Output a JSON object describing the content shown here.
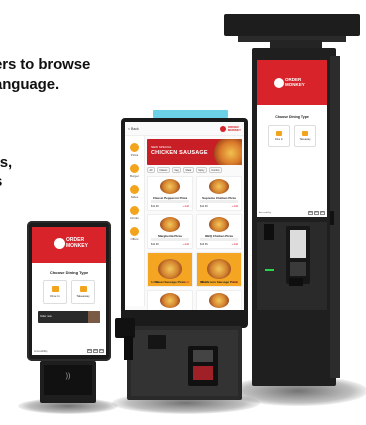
{
  "headline": {
    "line1": "ers to browse",
    "line2": "anguage.",
    "line3": "rs,",
    "line4": "s"
  },
  "brand": {
    "logo_line1": "ORDER",
    "logo_line2": "MONKEY",
    "color": "#d8232a",
    "accent": "#f2a41c"
  },
  "kiosk_left": {
    "title": "Choose Dining Type",
    "option1": "Dine In",
    "option2": "Takeaway",
    "promo": "Order now",
    "footer": "Accessibility",
    "langs": [
      "EN",
      "FR",
      "ES"
    ],
    "contactless_icon": "contactless-icon"
  },
  "kiosk_center": {
    "back": "< Back",
    "hero_sub": "NEW SPECIAL",
    "hero_title": "CHICKEN SAUSAGE",
    "categories": [
      "Pizza",
      "Burger",
      "Sides",
      "Drinks",
      "Offers"
    ],
    "tabs": [
      "All",
      "Classic",
      "Veg",
      "Meat",
      "Spicy",
      "Combo"
    ],
    "items": [
      {
        "name": "Classic Pepperoni Pizza",
        "price": "$12.99",
        "add": "+ Add"
      },
      {
        "name": "Supreme Chicken Pizza",
        "price": "$14.99",
        "add": "+ Add"
      },
      {
        "name": "Margherita Pizza",
        "price": "$10.99",
        "add": "+ Add"
      },
      {
        "name": "BBQ Chicken Pizza",
        "price": "$13.99",
        "add": "+ Add"
      },
      {
        "name": "Sweet Sausage Pizza",
        "price": "$12.49",
        "add": "+ Add"
      },
      {
        "name": "Mushroom Sausage Pizza",
        "price": "$13.49",
        "add": "+ Add"
      },
      {
        "name": "Garden Veg Pizza",
        "price": "$11.99",
        "add": "+ Add"
      },
      {
        "name": "Pepperoni Pizza",
        "price": "$12.99",
        "add": "+ Add"
      }
    ]
  },
  "kiosk_right": {
    "title": "Choose Dining Type",
    "option1": "Dine In",
    "option2": "Takeaway",
    "footer": "Accessibility",
    "langs": [
      "EN",
      "FR",
      "ES"
    ]
  }
}
